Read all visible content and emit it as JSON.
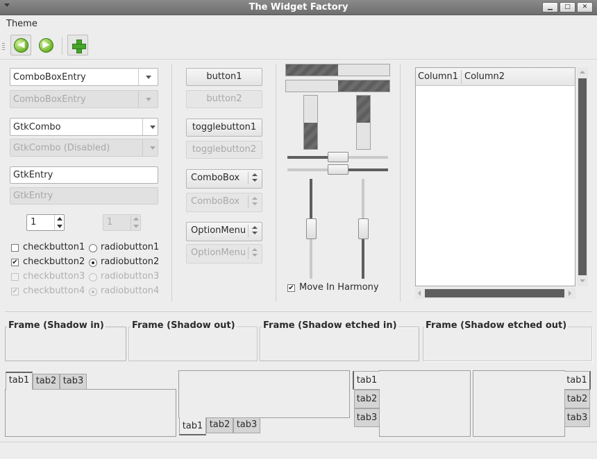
{
  "window": {
    "title": "The Widget Factory",
    "minimize": "▁",
    "maximize": "□",
    "close": "✕"
  },
  "menubar": {
    "theme": "Theme"
  },
  "toolbar": {
    "back_glyph": "◀",
    "forward_glyph": "▶",
    "icons": [
      "go-first-icon",
      "go-last-icon",
      "add-icon"
    ]
  },
  "col1": {
    "comboboxentry": "ComboBoxEntry",
    "comboboxentry_disabled": "ComboBoxEntry",
    "gtkcombo": "GtkCombo",
    "gtkcombo_disabled": "GtkCombo (Disabled)",
    "entry": "GtkEntry",
    "entry_disabled": "GtkEntry",
    "spin": "1",
    "spin_disabled": "1",
    "checks": [
      "checkbutton1",
      "checkbutton2",
      "checkbutton3",
      "checkbutton4"
    ],
    "radios": [
      "radiobutton1",
      "radiobutton2",
      "radiobutton3",
      "radiobutton4"
    ],
    "check_mark": "✔"
  },
  "col2": {
    "button1": "button1",
    "button2": "button2",
    "togglebutton1": "togglebutton1",
    "togglebutton2": "togglebutton2",
    "combobox": "ComboBox",
    "combobox_disabled": "ComboBox",
    "optionmenu": "OptionMenu",
    "optionmenu_disabled": "OptionMenu"
  },
  "col3": {
    "progress_h1": 0.5,
    "progress_h2": 0.5,
    "progress_v1": 0.5,
    "progress_v2": 0.5,
    "scale_h1": 0.5,
    "scale_h2": 0.5,
    "scale_v1": 0.5,
    "scale_v2": 0.5,
    "move_in_harmony": "Move In Harmony",
    "check_mark": "✔"
  },
  "treeview": {
    "columns": [
      "Column1",
      "Column2"
    ]
  },
  "frames": {
    "shadow_in": "Frame (Shadow in)",
    "shadow_out": "Frame (Shadow out)",
    "etched_in": "Frame (Shadow etched in)",
    "etched_out": "Frame (Shadow etched out)"
  },
  "notebooks": {
    "tabs": [
      "tab1",
      "tab2",
      "tab3"
    ]
  }
}
